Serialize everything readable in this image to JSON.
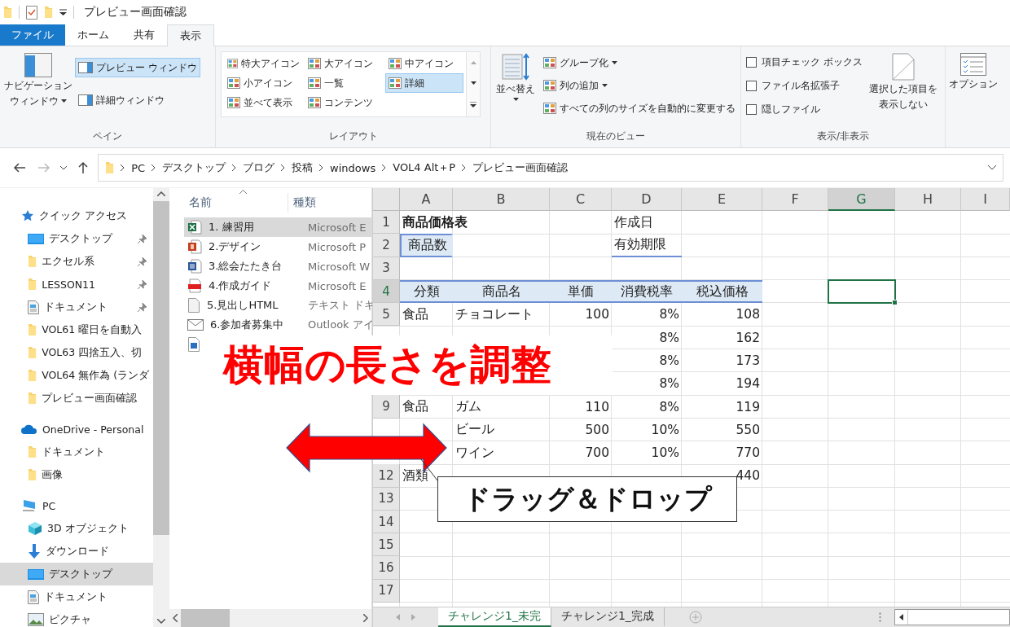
{
  "window": {
    "title": "プレビュー画面確認"
  },
  "ribbon_tabs": [
    {
      "label": "ファイル",
      "kind": "file",
      "selected": false
    },
    {
      "label": "ホーム",
      "kind": "tab",
      "selected": false
    },
    {
      "label": "共有",
      "kind": "tab",
      "selected": false
    },
    {
      "label": "表示",
      "kind": "tab",
      "selected": true
    }
  ],
  "ribbon_groups": [
    {
      "kind": "pane",
      "label": "ペイン",
      "large": {
        "lines": [
          "ナビゲーション",
          "ウィンドウ"
        ],
        "dropdown": true
      },
      "small": [
        {
          "label": "プレビュー ウィンドウ",
          "selected": true
        },
        {
          "label": "詳細ウィンドウ",
          "selected": false
        }
      ]
    },
    {
      "kind": "layout",
      "label": "レイアウト",
      "options": [
        {
          "label": "特大アイコン",
          "selected": false
        },
        {
          "label": "大アイコン",
          "selected": false
        },
        {
          "label": "中アイコン",
          "selected": false
        },
        {
          "label": "小アイコン",
          "selected": false
        },
        {
          "label": "一覧",
          "selected": false
        },
        {
          "label": "詳細",
          "selected": true
        },
        {
          "label": "並べて表示",
          "selected": false
        },
        {
          "label": "コンテンツ",
          "selected": false
        }
      ]
    },
    {
      "kind": "view",
      "label": "現在のビュー",
      "large": {
        "lines": [
          "並べ替え"
        ],
        "dropdown": true
      },
      "small": [
        {
          "label": "グループ化",
          "dropdown": true
        },
        {
          "label": "列の追加",
          "dropdown": true
        },
        {
          "label": "すべての列のサイズを自動的に変更する",
          "dropdown": false
        }
      ]
    },
    {
      "kind": "show_hide",
      "label": "表示/非表示",
      "checkboxes": [
        {
          "label": "項目チェック ボックス",
          "checked": false
        },
        {
          "label": "ファイル名拡張子",
          "checked": false
        },
        {
          "label": "隠しファイル",
          "checked": false
        }
      ],
      "large": {
        "lines": [
          "選択した項目を",
          "表示しない"
        ],
        "dropdown": false
      }
    },
    {
      "kind": "options",
      "large": {
        "lines": [
          "オプション"
        ],
        "dropdown": false
      }
    }
  ],
  "address": {
    "path": [
      "PC",
      "デスクトップ",
      "ブログ",
      "投稿",
      "windows",
      "VOL4 Alt＋P",
      "プレビュー画面確認"
    ]
  },
  "navigation": [
    {
      "label": "クイック アクセス",
      "kind": "star",
      "selected": false,
      "pinned": false,
      "children": [
        {
          "label": "デスクトップ",
          "kind": "desktop",
          "selected": false,
          "pinned": true
        },
        {
          "label": "エクセル系",
          "kind": "folder",
          "selected": false,
          "pinned": true
        },
        {
          "label": "LESSON11",
          "kind": "folder",
          "selected": false,
          "pinned": true
        },
        {
          "label": "ドキュメント",
          "kind": "document",
          "selected": false,
          "pinned": true
        },
        {
          "label": "VOL61 曜日を自動入",
          "kind": "folder",
          "selected": false,
          "pinned": false
        },
        {
          "label": "VOL63 四捨五入、切",
          "kind": "folder",
          "selected": false,
          "pinned": false
        },
        {
          "label": "VOL64 無作為 (ランダ",
          "kind": "folder",
          "selected": false,
          "pinned": false
        },
        {
          "label": "プレビュー画面確認",
          "kind": "folder",
          "selected": false,
          "pinned": false
        }
      ]
    },
    {
      "label": "OneDrive - Personal",
      "kind": "cloud",
      "selected": false,
      "pinned": false,
      "children": [
        {
          "label": "ドキュメント",
          "kind": "folder",
          "selected": false,
          "pinned": false
        },
        {
          "label": "画像",
          "kind": "folder",
          "selected": false,
          "pinned": false
        }
      ]
    },
    {
      "label": "PC",
      "kind": "pc",
      "selected": false,
      "pinned": false,
      "children": [
        {
          "label": "3D オブジェクト",
          "kind": "cube",
          "selected": false,
          "pinned": false
        },
        {
          "label": "ダウンロード",
          "kind": "download",
          "selected": false,
          "pinned": false
        },
        {
          "label": "デスクトップ",
          "kind": "desktop",
          "selected": true,
          "pinned": false
        },
        {
          "label": "ドキュメント",
          "kind": "document",
          "selected": false,
          "pinned": false
        },
        {
          "label": "ピクチャ",
          "kind": "pictures",
          "selected": false,
          "pinned": false
        }
      ]
    }
  ],
  "file_list": {
    "columns": [
      "名前",
      "種類"
    ],
    "files": [
      {
        "name": "1. 練習用",
        "type": "Microsoft E",
        "kind": "excel",
        "selected": true
      },
      {
        "name": "2.デザイン",
        "type": "Microsoft P",
        "kind": "powerpoint",
        "selected": false
      },
      {
        "name": "3.総会たたき台",
        "type": "Microsoft W",
        "kind": "word",
        "selected": false
      },
      {
        "name": "4.作成ガイド",
        "type": "Microsoft E",
        "kind": "pdf",
        "selected": false
      },
      {
        "name": "5.見出しHTML",
        "type": "テキスト ドキ",
        "kind": "text",
        "selected": false
      },
      {
        "name": "6.参加者募集中",
        "type": "Outlook アイ",
        "kind": "mail",
        "selected": false
      },
      {
        "kind": "image"
      }
    ]
  },
  "spreadsheet": {
    "columns": [
      {
        "label": "A",
        "selected": false
      },
      {
        "label": "B",
        "selected": false
      },
      {
        "label": "C",
        "selected": false
      },
      {
        "label": "D",
        "selected": false
      },
      {
        "label": "E",
        "selected": false
      },
      {
        "label": "F",
        "selected": false
      },
      {
        "label": "G",
        "selected": true
      },
      {
        "label": "H",
        "selected": false
      },
      {
        "label": "I",
        "selected": false
      }
    ],
    "rows": [
      {
        "number": "1",
        "selected": false,
        "cells": {
          "A": {
            "text": "商品価格表",
            "kind": "title"
          },
          "D": {
            "text": "作成日",
            "kind": "label"
          }
        }
      },
      {
        "number": "2",
        "selected": false,
        "cells": {
          "A": {
            "text": "商品数",
            "kind": "boxed-label"
          },
          "D": {
            "text": "有効期限",
            "kind": "underlined-label"
          }
        }
      },
      {
        "number": "3",
        "selected": false,
        "cells": {}
      },
      {
        "number": "4",
        "selected": true,
        "cells": {
          "A": {
            "text": "分類",
            "kind": "header"
          },
          "B": {
            "text": "商品名",
            "kind": "header"
          },
          "C": {
            "text": "単価",
            "kind": "header"
          },
          "D": {
            "text": "消費税率",
            "kind": "header"
          },
          "E": {
            "text": "税込価格",
            "kind": "header"
          }
        }
      },
      {
        "number": "5",
        "selected": false,
        "cells": {
          "A": {
            "text": "食品",
            "kind": "text"
          },
          "B": {
            "text": "チョコレート",
            "kind": "text"
          },
          "C": {
            "text": "100",
            "kind": "number"
          },
          "D": {
            "text": "8%",
            "kind": "number"
          },
          "E": {
            "text": "108",
            "kind": "number"
          }
        }
      },
      {
        "cells": {
          "D": {
            "text": "8%",
            "kind": "number"
          },
          "E": {
            "text": "162",
            "kind": "number"
          }
        }
      },
      {
        "cells": {
          "D": {
            "text": "8%",
            "kind": "number"
          },
          "E": {
            "text": "173",
            "kind": "number"
          }
        }
      },
      {
        "cells": {
          "D": {
            "text": "8%",
            "kind": "number"
          },
          "E": {
            "text": "194",
            "kind": "number"
          }
        }
      },
      {
        "number": "9",
        "selected": false,
        "cells": {
          "A": {
            "text": "食品",
            "kind": "text"
          },
          "B": {
            "text": "ガム",
            "kind": "text"
          },
          "C": {
            "text": "110",
            "kind": "number"
          },
          "D": {
            "text": "8%",
            "kind": "number"
          },
          "E": {
            "text": "119",
            "kind": "number"
          }
        }
      },
      {
        "cells": {
          "B": {
            "text": "ビール",
            "kind": "text"
          },
          "C": {
            "text": "500",
            "kind": "number"
          },
          "D": {
            "text": "10%",
            "kind": "number"
          },
          "E": {
            "text": "550",
            "kind": "number"
          }
        }
      },
      {
        "cells": {
          "B": {
            "text": "ワイン",
            "kind": "text"
          },
          "C": {
            "text": "700",
            "kind": "number"
          },
          "D": {
            "text": "10%",
            "kind": "number"
          },
          "E": {
            "text": "770",
            "kind": "number"
          }
        }
      },
      {
        "number": "12",
        "selected": false,
        "cells": {
          "A": {
            "text": "酒類",
            "kind": "text"
          },
          "E": {
            "text": "440",
            "kind": "number"
          }
        }
      },
      {
        "number": "13",
        "selected": false,
        "cells": {}
      },
      {
        "number": "14",
        "selected": false,
        "cells": {}
      },
      {
        "number": "15",
        "selected": false,
        "cells": {}
      },
      {
        "number": "16",
        "selected": false,
        "cells": {}
      },
      {
        "number": "17",
        "selected": false,
        "cells": {}
      }
    ]
  },
  "sheet_tabs": [
    {
      "label": "チャレンジ1_未完",
      "selected": true
    },
    {
      "label": "チャレンジ1_完成",
      "selected": false
    }
  ],
  "annotation": {
    "headline": "横幅の長さを調整",
    "callout": "ドラッグ＆ドロップ"
  }
}
